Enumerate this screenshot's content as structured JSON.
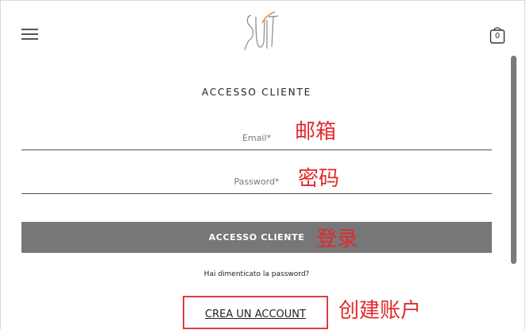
{
  "header": {
    "menu_icon": "hamburger-menu-icon",
    "logo_icon": "brand-logo",
    "cart_icon": "shopping-bag-icon",
    "cart_count": "0"
  },
  "login": {
    "title": "ACCESSO CLIENTE",
    "email_placeholder": "Email*",
    "email_value": "",
    "password_placeholder": "Password*",
    "password_value": "",
    "submit_label": "ACCESSO CLIENTE",
    "forgot_label": "Hai dimenticato la password?",
    "create_account_label": "CREA UN ACCOUNT"
  },
  "annotations": {
    "email": "邮箱",
    "password": "密码",
    "login": "登录",
    "create_account": "创建账户"
  },
  "colors": {
    "button_bg": "#777777",
    "annotation_red": "#e32a2a",
    "logo_accent": "#e8894a"
  }
}
